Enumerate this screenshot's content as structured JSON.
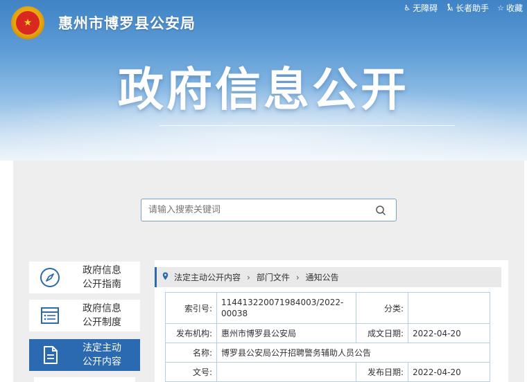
{
  "header": {
    "site_title": "惠州市博罗县公安局",
    "big_title": "政府信息公开",
    "toplinks": [
      {
        "icon": "wheelchair-icon",
        "label": "无障碍"
      },
      {
        "icon": "elder-assist-icon",
        "label": "长者助手"
      },
      {
        "icon": "star-icon",
        "label": "收藏"
      }
    ]
  },
  "search": {
    "placeholder": "请输入搜索关键词"
  },
  "sidebar": {
    "items": [
      {
        "label_line1": "政府信息",
        "label_line2": "公开指南",
        "icon": "compass-icon",
        "active": false
      },
      {
        "label_line1": "政府信息",
        "label_line2": "公开制度",
        "icon": "list-doc-icon",
        "active": false
      },
      {
        "label_line1": "法定主动",
        "label_line2": "公开内容",
        "icon": "document-icon",
        "active": true
      }
    ]
  },
  "breadcrumb": {
    "icon": "location-pin-icon",
    "items": [
      "法定主动公开内容",
      "部门文件",
      "通知公告"
    ]
  },
  "meta": {
    "index_label": "索引号:",
    "index_value_line1": "114413220071984003/2022-",
    "index_value_line2": "00038",
    "category_label": "分类:",
    "category_value": "",
    "publisher_label": "发布机构:",
    "publisher_value": "惠州市博罗县公安局",
    "created_label": "成文日期:",
    "created_value": "2022-04-20",
    "name_label": "名称:",
    "name_value": "博罗县公安局公开招聘警务辅助人员公告",
    "doc_no_label": "文号:",
    "doc_no_value": "",
    "published_label": "发布日期:",
    "published_value": "2022-04-20"
  },
  "colors": {
    "primary": "#2b69b0",
    "banner_top": "#3f83c6",
    "panel_bg": "#eeeeee",
    "table_border": "#b9cde2"
  }
}
